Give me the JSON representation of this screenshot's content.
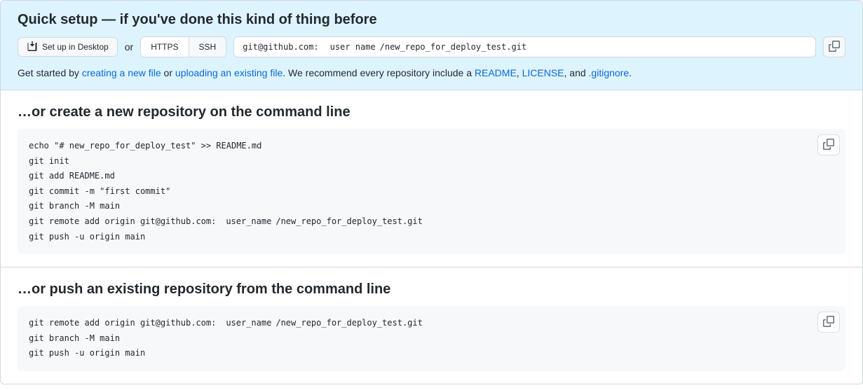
{
  "quick_setup": {
    "title": "Quick setup — if you've done this kind of thing before",
    "setup_desktop_label": "Set up in Desktop",
    "or_label": "or",
    "https_label": "HTTPS",
    "ssh_label": "SSH",
    "url_prefix": "git@github.com:",
    "url_user": "user name",
    "url_path": "/new_repo_for_deploy_test.git",
    "help_prefix": "Get started by ",
    "link_new_file": "creating a new file",
    "help_or": " or ",
    "link_upload": "uploading an existing file",
    "help_mid": ". We recommend every repository include a ",
    "link_readme": "README",
    "comma1": ", ",
    "link_license": "LICENSE",
    "comma2": ", and ",
    "link_gitignore": ".gitignore",
    "period": "."
  },
  "section1": {
    "title": "…or create a new repository on the command line",
    "line1": "echo \"# new_repo_for_deploy_test\" >> README.md",
    "line2": "git init",
    "line3": "git add README.md",
    "line4": "git commit -m \"first commit\"",
    "line5": "git branch -M main",
    "line6_prefix": "git remote add origin git@github.com:",
    "line6_user": "user_name",
    "line6_path": "/new_repo_for_deploy_test.git",
    "line7": "git push -u origin main"
  },
  "section2": {
    "title": "…or push an existing repository from the command line",
    "line1_prefix": "git remote add origin git@github.com:",
    "line1_user": "user_name",
    "line1_path": "/new_repo_for_deploy_test.git",
    "line2": "git branch -M main",
    "line3": "git push -u origin main"
  }
}
